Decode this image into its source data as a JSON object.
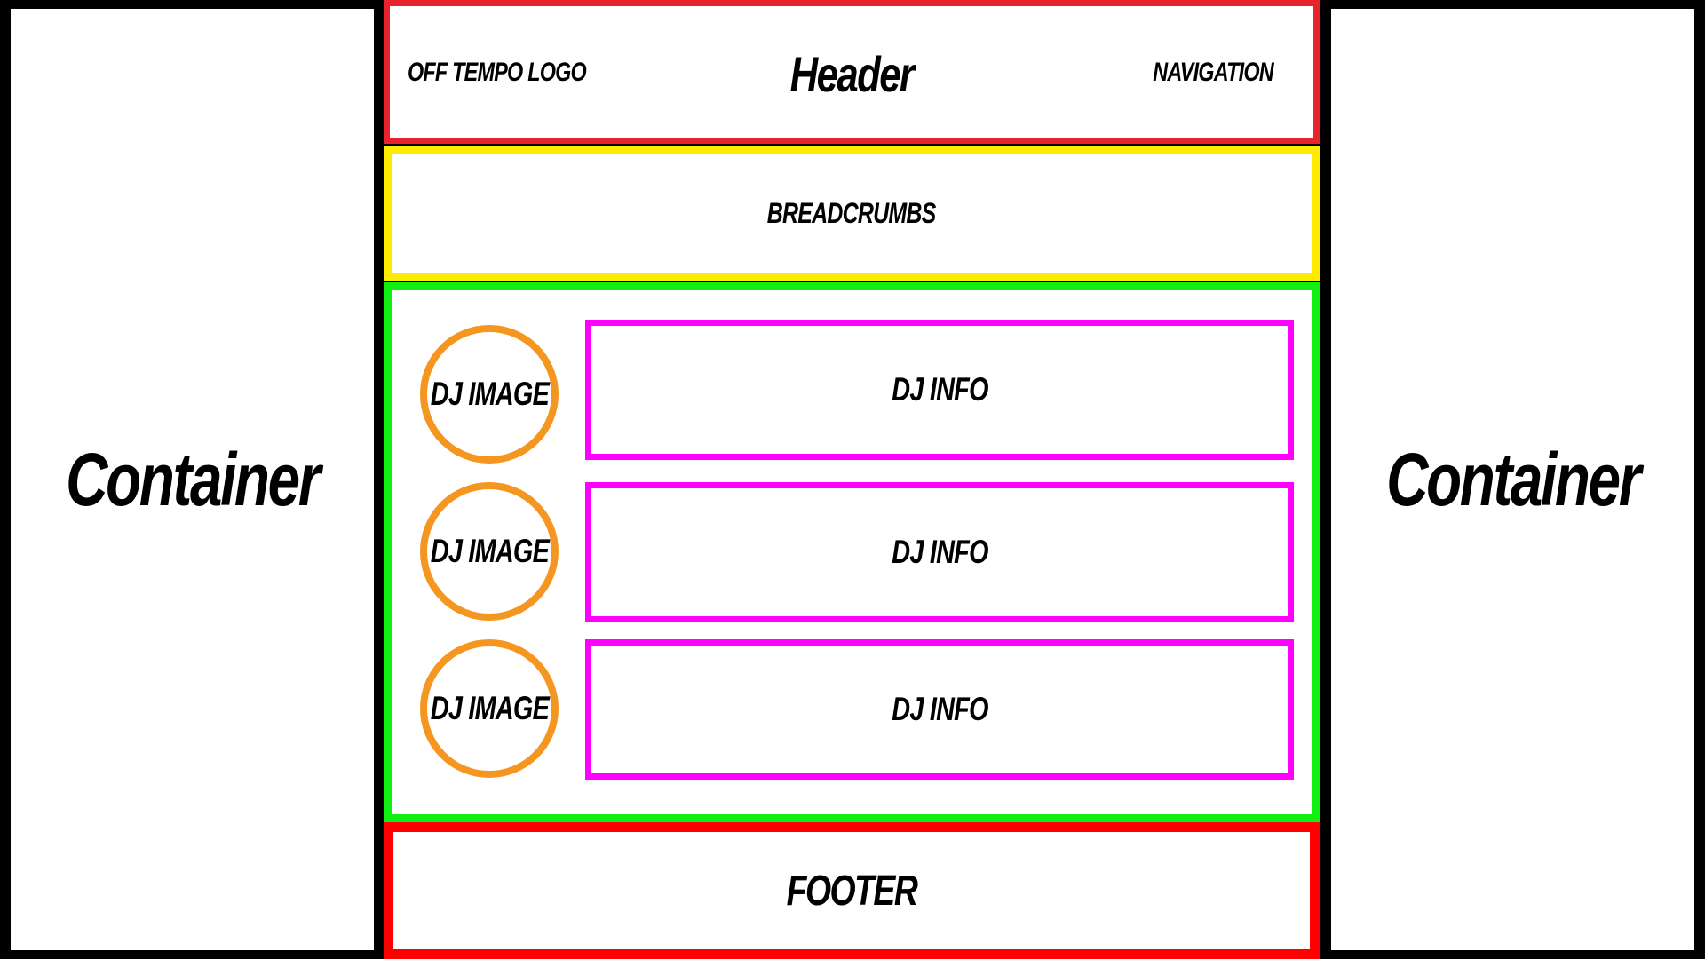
{
  "diagram": {
    "left_container": {
      "label": "Container"
    },
    "right_container": {
      "label": "Container"
    },
    "header": {
      "logo": "OFF TEMPO LOGO",
      "title": "Header",
      "navigation": "NAVIGATION"
    },
    "breadcrumbs": {
      "label": "BREADCRUMBS"
    },
    "main": {
      "rows": [
        {
          "image_label": "DJ IMAGE",
          "info_label": "DJ INFO"
        },
        {
          "image_label": "DJ IMAGE",
          "info_label": "DJ INFO"
        },
        {
          "image_label": "DJ IMAGE",
          "info_label": "DJ INFO"
        }
      ]
    },
    "footer": {
      "label": "FOOTER"
    }
  },
  "colors": {
    "background": "#000000",
    "panel": "#ffffff",
    "header_border": "#e8232b",
    "breadcrumbs_border": "#ffeb00",
    "main_border": "#11ee11",
    "dj_image_border": "#f4961f",
    "dj_info_border": "#ff00ff",
    "footer_border": "#ff0000"
  }
}
